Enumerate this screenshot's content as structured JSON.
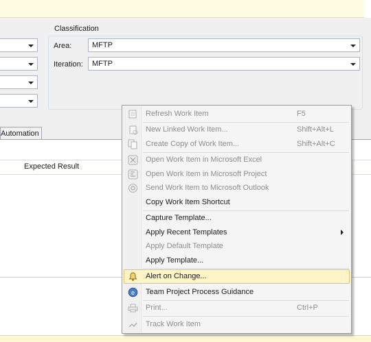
{
  "classification": {
    "title": "Classification",
    "area_label": "Area:",
    "area_value": "MFTP",
    "iteration_label": "Iteration:",
    "iteration_value": "MFTP"
  },
  "tabs": {
    "automation": "Automation"
  },
  "grid": {
    "columns": [
      "Expected Result"
    ]
  },
  "context_menu": {
    "items": [
      {
        "label": "Refresh Work Item",
        "shortcut": "F5",
        "enabled": false,
        "icon": "refresh-icon"
      },
      {
        "label": "New Linked Work Item...",
        "shortcut": "Shift+Alt+L",
        "enabled": false,
        "icon": "new-linked-icon"
      },
      {
        "label": "Create Copy of Work Item...",
        "shortcut": "Shift+Alt+C",
        "enabled": false,
        "icon": "copy-item-icon"
      },
      {
        "label": "Open Work Item in Microsoft Excel",
        "shortcut": "",
        "enabled": false,
        "icon": "excel-icon"
      },
      {
        "label": "Open Work Item in Microsoft Project",
        "shortcut": "",
        "enabled": false,
        "icon": "project-icon"
      },
      {
        "label": "Send Work Item to Microsoft Outlook",
        "shortcut": "",
        "enabled": false,
        "icon": "outlook-icon"
      },
      {
        "label": "Copy Work Item Shortcut",
        "shortcut": "",
        "enabled": true,
        "icon": ""
      },
      {
        "label": "Capture Template...",
        "shortcut": "",
        "enabled": true,
        "icon": ""
      },
      {
        "label": "Apply Recent Templates",
        "shortcut": "",
        "enabled": true,
        "icon": "",
        "submenu": true
      },
      {
        "label": "Apply Default Template",
        "shortcut": "",
        "enabled": false,
        "icon": ""
      },
      {
        "label": "Apply Template...",
        "shortcut": "",
        "enabled": true,
        "icon": ""
      },
      {
        "label": "Alert on Change...",
        "shortcut": "",
        "enabled": true,
        "icon": "alert-bell-icon",
        "highlighted": true
      },
      {
        "label": "Team Project Process Guidance",
        "shortcut": "",
        "enabled": true,
        "icon": "guidance-icon"
      },
      {
        "label": "Print...",
        "shortcut": "Ctrl+P",
        "enabled": false,
        "icon": "printer-icon"
      },
      {
        "label": "Track Work Item",
        "shortcut": "",
        "enabled": false,
        "icon": "track-icon"
      }
    ]
  },
  "colors": {
    "menu_highlight": "#fdf4c8",
    "menu_highlight_border": "#e5c365",
    "disabled_text": "#8d8d8d",
    "infobar": "#fffbe1"
  }
}
